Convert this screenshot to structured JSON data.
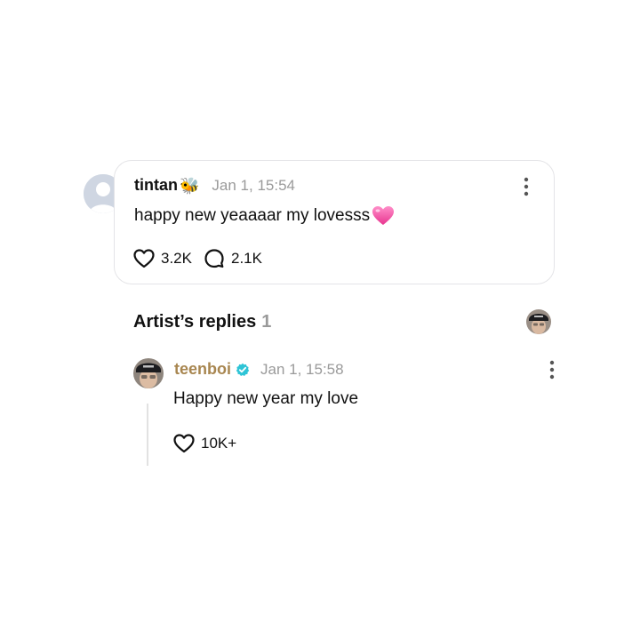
{
  "post": {
    "username": "tintan",
    "username_emoji": "🐝",
    "timestamp": "Jan 1, 15:54",
    "text": "happy new yeaaaar my lovesss",
    "text_emoji": "heart-emoji",
    "likes": "3.2K",
    "comments": "2.1K"
  },
  "replies_section": {
    "title": "Artist’s replies",
    "count": "1"
  },
  "reply": {
    "username": "teenboi",
    "timestamp": "Jan 1, 15:58",
    "text": "Happy new year my love",
    "likes": "10K+"
  },
  "colors": {
    "artist_name": "#a88650",
    "verified": "#2ec4d6",
    "heart_emoji": "#f25aa8",
    "muted_text": "#9a9a9a"
  }
}
